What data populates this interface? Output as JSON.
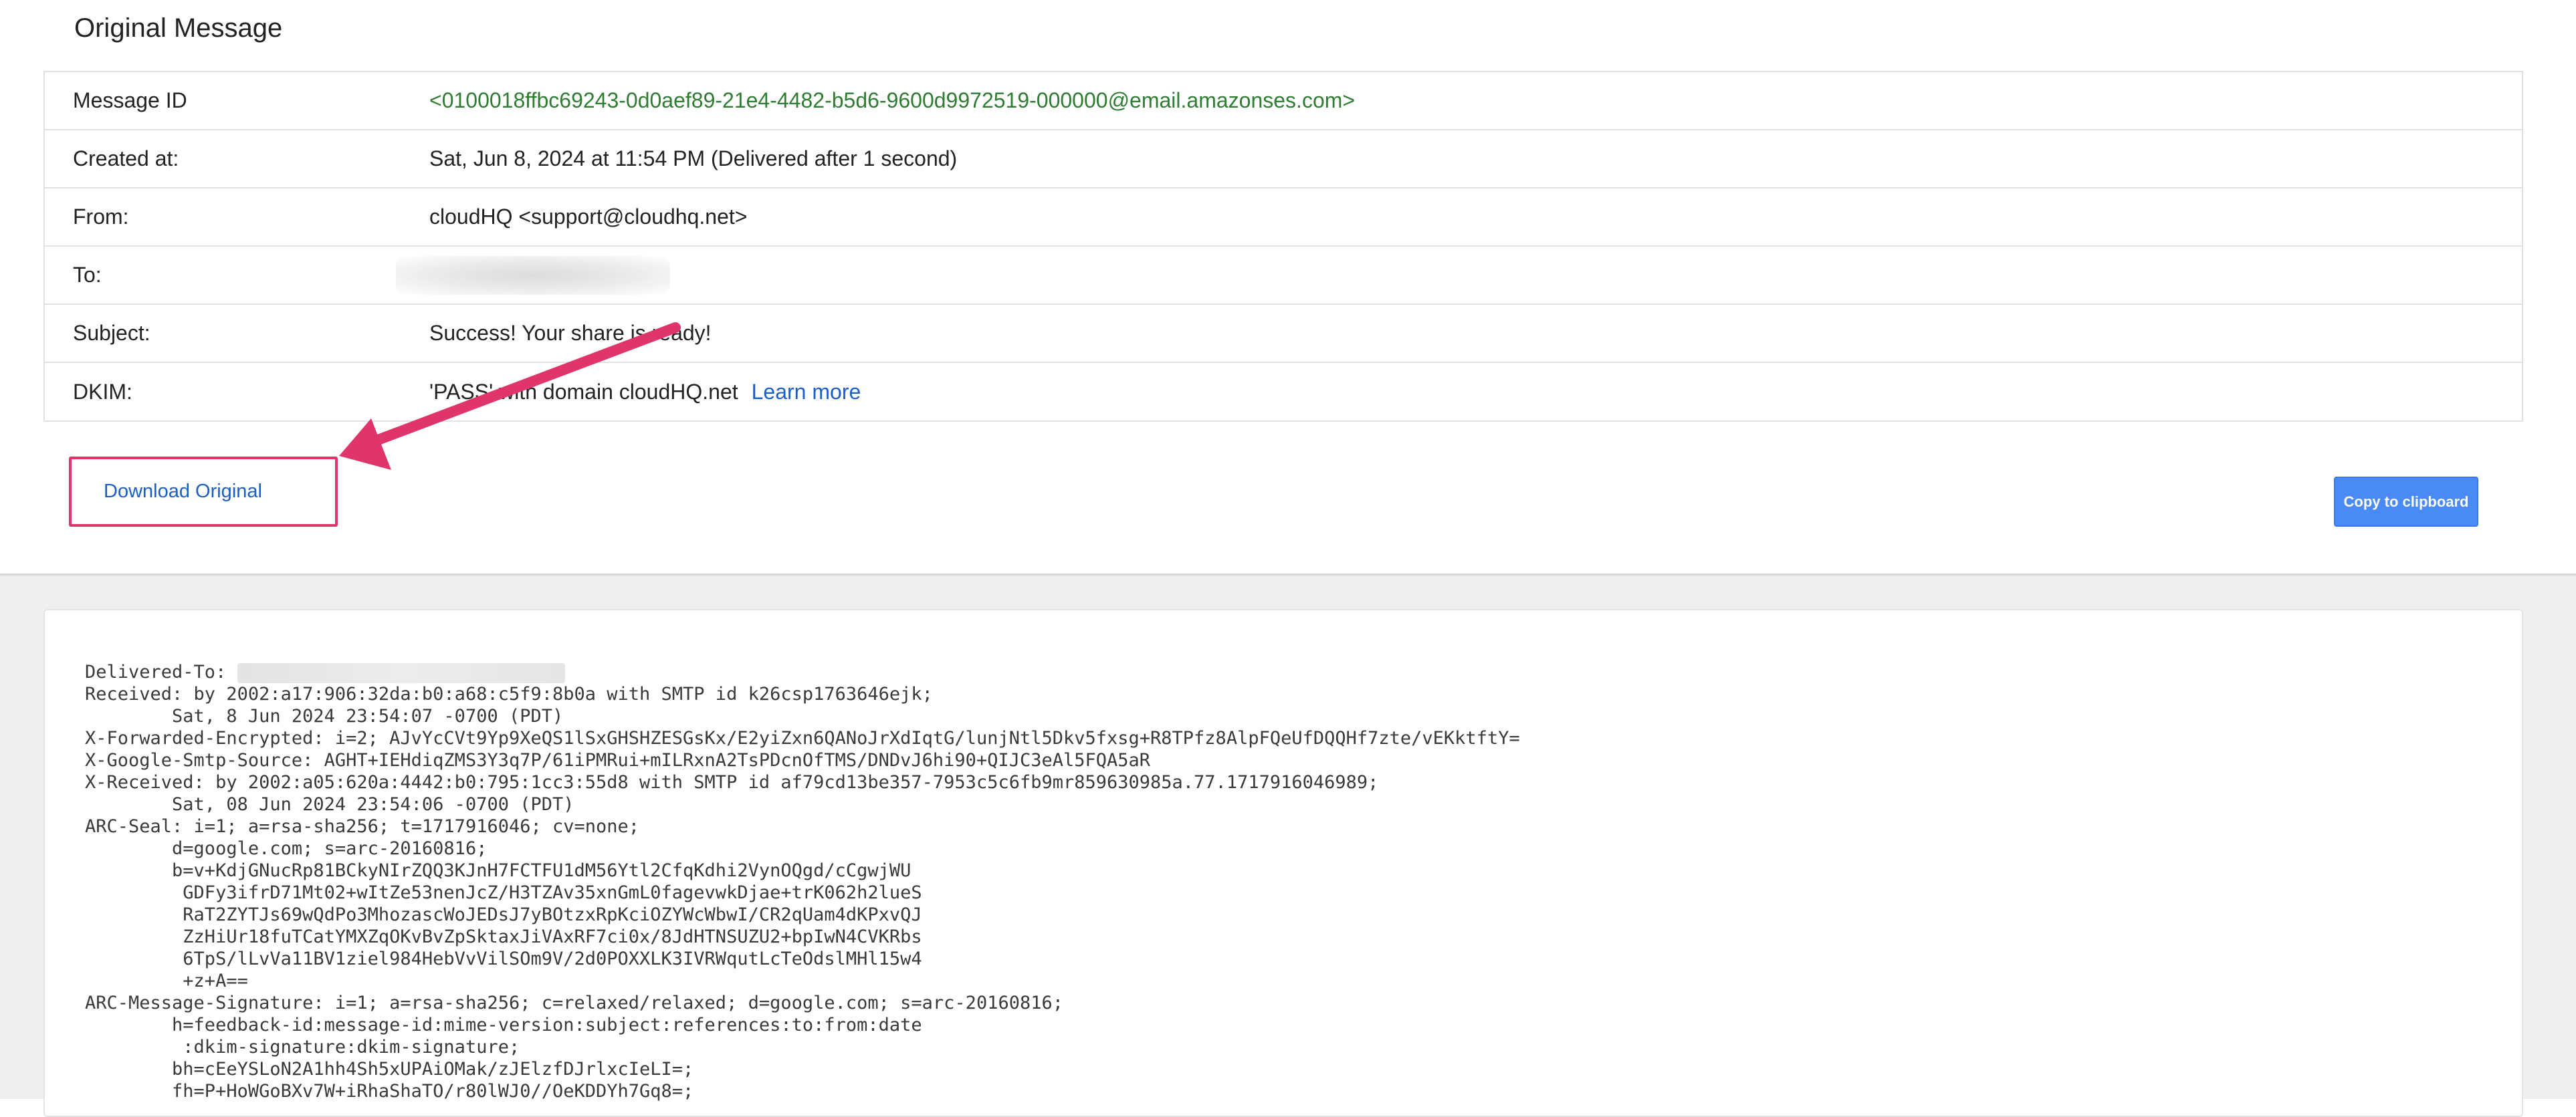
{
  "title": "Original Message",
  "details": [
    {
      "label": "Message ID",
      "value": "<0100018ffbc69243-0d0aef89-21e4-4482-b5d6-9600d9972519-000000@email.amazonses.com>"
    },
    {
      "label": "Created at:",
      "value": "Sat, Jun 8, 2024 at 11:54 PM (Delivered after 1 second)"
    },
    {
      "label": "From:",
      "value": "cloudHQ <support@cloudhq.net>"
    },
    {
      "label": "To:",
      "value": ""
    },
    {
      "label": "Subject:",
      "value": "Success! Your share is ready!"
    },
    {
      "label": "DKIM:",
      "value": "'PASS' with domain cloudHQ.net",
      "link": "Learn more"
    }
  ],
  "actions": {
    "download": "Download Original",
    "copy": "Copy to clipboard"
  },
  "colors": {
    "message_id": "#2e7d32",
    "link": "#1a5fc8",
    "highlight": "#e0356b",
    "button": "#4a8af4"
  },
  "raw_lines": [
    "Delivered-To: ",
    "Received: by 2002:a17:906:32da:b0:a68:c5f9:8b0a with SMTP id k26csp1763646ejk;",
    "        Sat, 8 Jun 2024 23:54:07 -0700 (PDT)",
    "X-Forwarded-Encrypted: i=2; AJvYcCVt9Yp9XeQS1lSxGHSHZESGsKx/E2yiZxn6QANoJrXdIqtG/lunjNtl5Dkv5fxsg+R8TPfz8AlpFQeUfDQQHf7zte/vEKktftY=",
    "X-Google-Smtp-Source: AGHT+IEHdiqZMS3Y3q7P/61iPMRui+mILRxnA2TsPDcnOfTMS/DNDvJ6hi90+QIJC3eAl5FQA5aR",
    "X-Received: by 2002:a05:620a:4442:b0:795:1cc3:55d8 with SMTP id af79cd13be357-7953c5c6fb9mr859630985a.77.1717916046989;",
    "        Sat, 08 Jun 2024 23:54:06 -0700 (PDT)",
    "ARC-Seal: i=1; a=rsa-sha256; t=1717916046; cv=none;",
    "        d=google.com; s=arc-20160816;",
    "        b=v+KdjGNucRp81BCkyNIrZQQ3KJnH7FCTFU1dM56Ytl2CfqKdhi2VynOQgd/cCgwjWU",
    "         GDFy3ifrD71Mt02+wItZe53nenJcZ/H3TZAv35xnGmL0fagevwkDjae+trK062h2lueS",
    "         RaT2ZYTJs69wQdPo3MhozascWoJEDsJ7yBOtzxRpKciOZYWcWbwI/CR2qUam4dKPxvQJ",
    "         ZzHiUr18fuTCatYMXZqOKvBvZpSktaxJiVAxRF7ci0x/8JdHTNSUZU2+bpIwN4CVKRbs",
    "         6TpS/lLvVa11BV1ziel984HebVvVilSOm9V/2d0POXXLK3IVRWqutLcTeOdslMHl15w4",
    "         +z+A==",
    "ARC-Message-Signature: i=1; a=rsa-sha256; c=relaxed/relaxed; d=google.com; s=arc-20160816;",
    "        h=feedback-id:message-id:mime-version:subject:references:to:from:date",
    "         :dkim-signature:dkim-signature;",
    "        bh=cEeYSLoN2A1hh4Sh5xUPAiOMak/zJElzfDJrlxcIeLI=;",
    "        fh=P+HoWGoBXv7W+iRhaShaTO/r80lWJ0//OeKDDYh7Gq8=;"
  ]
}
